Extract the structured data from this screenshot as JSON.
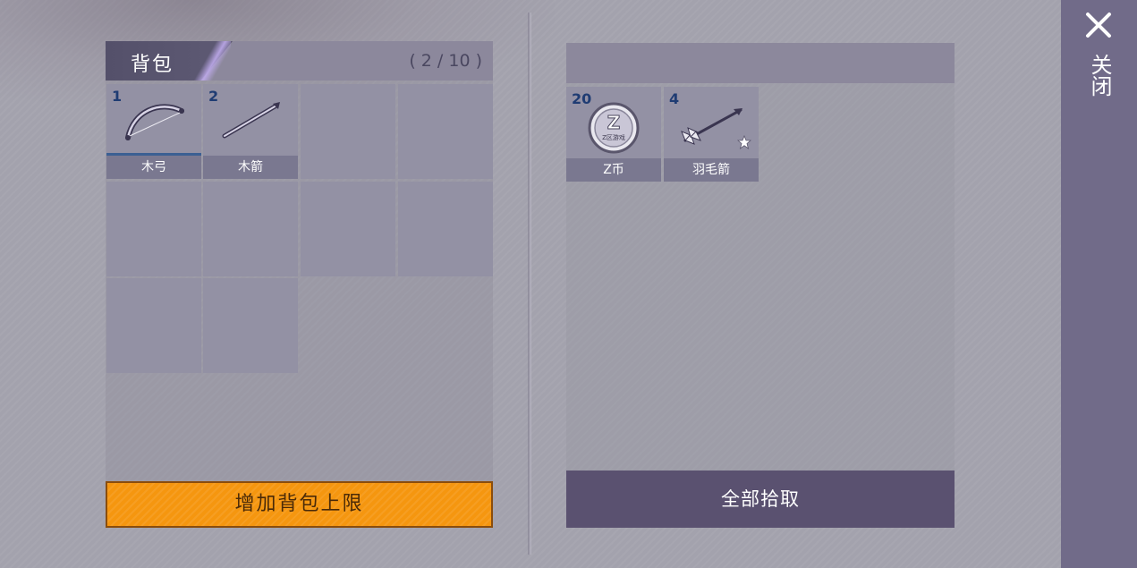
{
  "backpack": {
    "title": "背包",
    "capacity": "( 2 / 10 )",
    "slots": [
      {
        "count": "1",
        "label": "木弓",
        "icon": "wooden-bow-icon",
        "selected": true
      },
      {
        "count": "2",
        "label": "木箭",
        "icon": "wooden-arrow-icon",
        "selected": false
      }
    ],
    "expand_label": "增加背包上限"
  },
  "ground": {
    "slots": [
      {
        "count": "20",
        "label": "Z币",
        "icon": "z-coin-icon",
        "coin_text": "Z区游戏"
      },
      {
        "count": "4",
        "label": "羽毛箭",
        "icon": "feather-arrow-icon"
      }
    ],
    "pickup_all_label": "全部拾取"
  },
  "close": {
    "label": "关闭"
  },
  "colors": {
    "accent_orange": "#f5960f",
    "count_blue": "#1f3c73",
    "sidebar": "#716b89",
    "pickup_button": "#5a5170"
  }
}
